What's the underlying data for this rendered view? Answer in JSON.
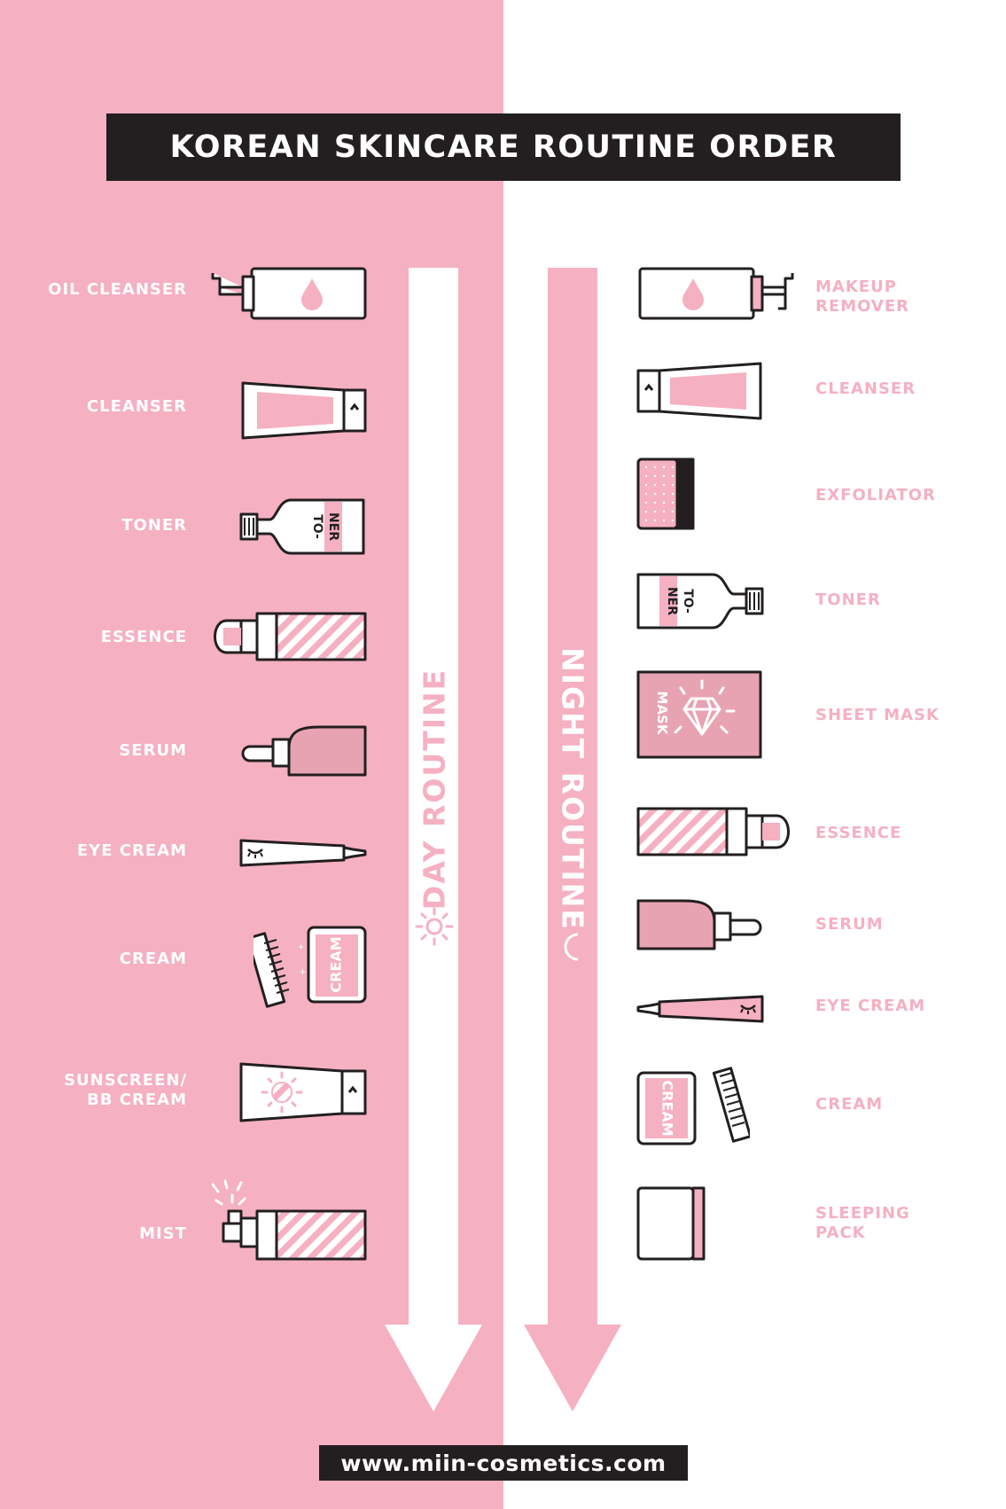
{
  "title": "KOREAN SKINCARE ROUTINE ORDER",
  "day": {
    "route_label": "DAY ROUTINE",
    "icon": "sun-icon",
    "steps": [
      {
        "label": "OIL CLEANSER",
        "icon": "pump-bottle-icon"
      },
      {
        "label": "CLEANSER",
        "icon": "tube-icon"
      },
      {
        "label": "TONER",
        "icon": "toner-bottle-icon",
        "icon_text": "TO-NER"
      },
      {
        "label": "ESSENCE",
        "icon": "essence-bottle-icon"
      },
      {
        "label": "SERUM",
        "icon": "dropper-bottle-icon"
      },
      {
        "label": "EYE CREAM",
        "icon": "eye-cream-tube-icon"
      },
      {
        "label": "CREAM",
        "icon": "cream-jar-icon",
        "icon_text": "CREAM"
      },
      {
        "label": "SUNSCREEN/\nBB CREAM",
        "icon": "sunscreen-tube-icon"
      },
      {
        "label": "MIST",
        "icon": "mist-spray-icon"
      }
    ]
  },
  "night": {
    "route_label": "NIGHT ROUTINE",
    "icon": "moon-icon",
    "steps": [
      {
        "label": "MAKEUP\nREMOVER",
        "icon": "pump-bottle-icon"
      },
      {
        "label": "CLEANSER",
        "icon": "tube-icon"
      },
      {
        "label": "EXFOLIATOR",
        "icon": "exfoliator-box-icon"
      },
      {
        "label": "TONER",
        "icon": "toner-bottle-icon",
        "icon_text": "TO-NER"
      },
      {
        "label": "SHEET MASK",
        "icon": "sheet-mask-icon",
        "icon_text": "MASK"
      },
      {
        "label": "ESSENCE",
        "icon": "essence-bottle-icon"
      },
      {
        "label": "SERUM",
        "icon": "dropper-bottle-icon"
      },
      {
        "label": "EYE CREAM",
        "icon": "eye-cream-tube-icon"
      },
      {
        "label": "CREAM",
        "icon": "cream-jar-icon",
        "icon_text": "CREAM"
      },
      {
        "label": "SLEEPING\nPACK",
        "icon": "sleeping-pack-jar-icon"
      }
    ]
  },
  "footer": "www.miin-cosmetics.com",
  "colors": {
    "pink": "#f5b0c1",
    "dark": "#231f20",
    "white": "#ffffff",
    "mid_pink": "#e8a3b2"
  }
}
